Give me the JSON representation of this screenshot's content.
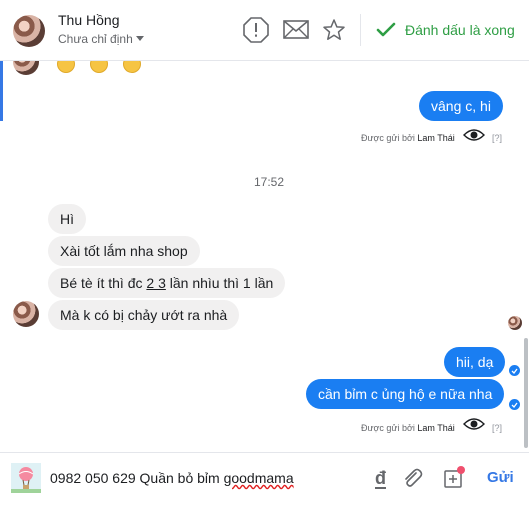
{
  "header": {
    "name": "Thu Hồng",
    "assign_label": "Chưa chỉ định",
    "done_label": "Đánh dấu là xong"
  },
  "messages": {
    "out1": "vâng c, hi",
    "meta_prefix": "Được gửi bởi",
    "meta_agent": "Lam Thái",
    "meta_q": "[?]",
    "time": "17:52",
    "in1": "Hì",
    "in2": "Xài tốt lắm nha shop",
    "in3_a": "Bé tè ít thì đc ",
    "in3_b": "2 3",
    "in3_c": " lần nhìu thì 1 lần",
    "in4": "Mà k có bị chảy ướt ra nhà",
    "out2": "hii, dạ",
    "out3": "cần bỉm c ủng hộ e nữa nha"
  },
  "composer": {
    "text_a": "0982 050 629 Quần bỏ bỉm ",
    "text_b": "goodmama",
    "send_label": "Gửi"
  },
  "colors": {
    "accent": "#1a7ef2",
    "done_green": "#2e9e44",
    "send_blue": "#3578e5"
  }
}
